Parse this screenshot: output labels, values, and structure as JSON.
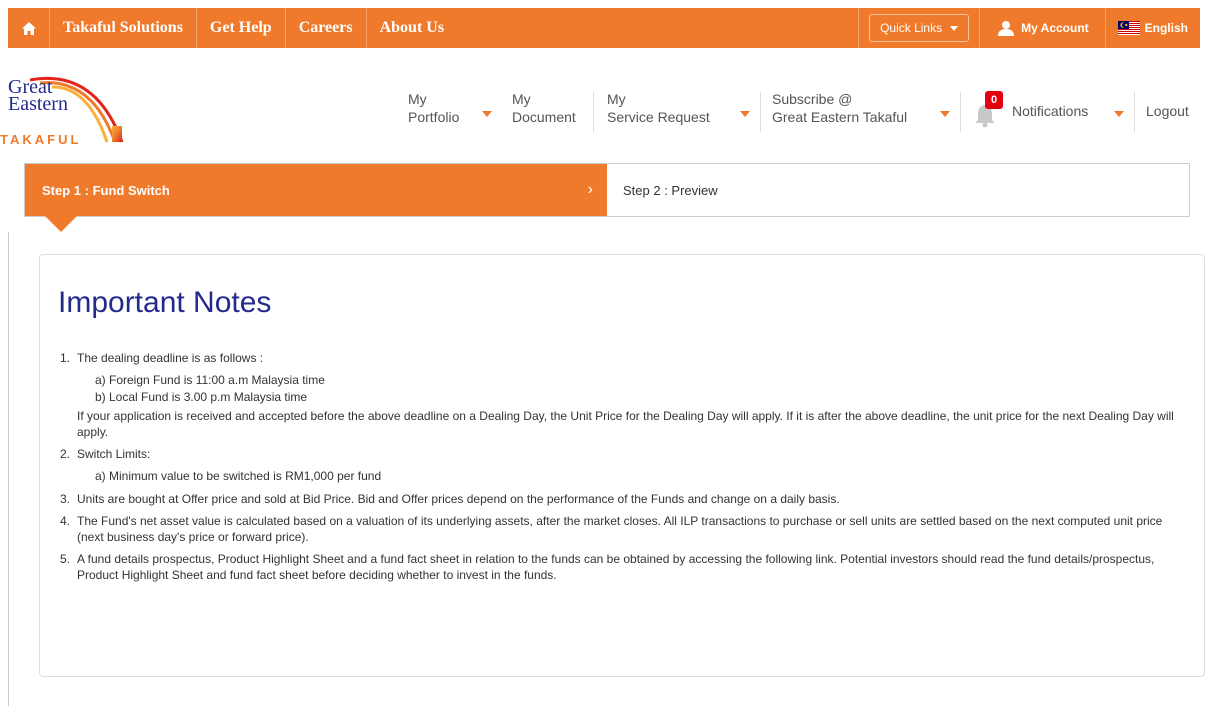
{
  "topbar": {
    "links": [
      "Takaful Solutions",
      "Get Help",
      "Careers",
      "About Us"
    ],
    "quick_links": "Quick Links",
    "my_account": "My Account",
    "language": "English",
    "color": "#f07a2b"
  },
  "logo": {
    "line1": "Great",
    "line2": "Eastern",
    "line3": "TAKAFUL"
  },
  "header_nav": {
    "portfolio_1": "My",
    "portfolio_2": "Portfolio",
    "document_1": "My",
    "document_2": "Document",
    "service_1": "My",
    "service_2": "Service Request",
    "subscribe_1": "Subscribe @",
    "subscribe_2": "Great Eastern Takaful",
    "notifications": "Notifications",
    "notification_count": "0",
    "logout": "Logout"
  },
  "steps": {
    "step1": "Step 1 : Fund Switch",
    "step1_chevron": "›",
    "step2": "Step 2 : Preview"
  },
  "content": {
    "title": "Important Notes",
    "notes": [
      {
        "num": "1.",
        "text": "The dealing deadline is as follows :",
        "sub": [
          "a) Foreign Fund is 11:00 a.m Malaysia time",
          "b) Local Fund is 3.00 p.m Malaysia time"
        ],
        "para": "If your application is received and accepted before the above deadline on a Dealing Day, the Unit Price for the Dealing Day will apply. If it is after the above deadline, the unit price for the next Dealing Day will apply."
      },
      {
        "num": "2.",
        "text": "Switch Limits:",
        "sub": [
          "a) Minimum value to be switched is RM1,000 per fund"
        ]
      },
      {
        "num": "3.",
        "text": "Units are bought at Offer price and sold at Bid Price. Bid and Offer prices depend on the performance of the Funds and change on a daily basis."
      },
      {
        "num": "4.",
        "text": "The Fund's net asset value is calculated based on a valuation of its underlying assets, after the market closes. All ILP transactions to purchase or sell units are settled based on the next computed unit price (next business day's price or forward price)."
      },
      {
        "num": "5.",
        "text": "A fund details prospectus, Product Highlight Sheet and a fund fact sheet in relation to the funds can be obtained by accessing the following link. Potential investors should read the fund details/prospectus, Product Highlight Sheet and fund fact sheet before deciding whether to invest in the funds."
      }
    ]
  }
}
